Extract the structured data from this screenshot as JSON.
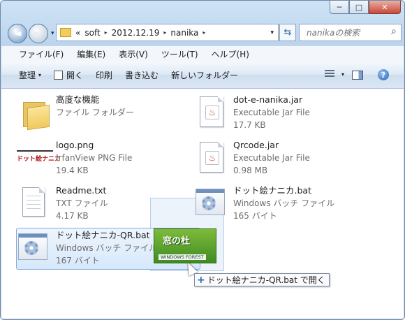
{
  "window": {
    "caption": {
      "minimize": "─",
      "maximize": "□",
      "close": "✕"
    }
  },
  "nav": {
    "back_icon": "back-arrow-icon",
    "forward_icon": "forward-arrow-icon",
    "back_glyph": "◄",
    "forward_glyph": "►",
    "history_glyph": "▾"
  },
  "address": {
    "overflow": "«",
    "crumbs": [
      "soft",
      "2012.12.19",
      "nanika"
    ],
    "separator": "▸",
    "dropdown": "▾"
  },
  "refresh_glyph": "⇆",
  "search": {
    "placeholder": "nanikaの検索",
    "icon_glyph": "⌕"
  },
  "menu": [
    "ファイル(F)",
    "編集(E)",
    "表示(V)",
    "ツール(T)",
    "ヘルプ(H)"
  ],
  "commands": {
    "organize": "整理",
    "open": "開く",
    "print": "印刷",
    "burn": "書き込む",
    "new_folder": "新しいフォルダー",
    "dropdown": "▾",
    "help": "?"
  },
  "files": [
    {
      "name": "高度な機能",
      "type": "ファイル フォルダー",
      "size": "",
      "icon": "folder-icon"
    },
    {
      "name": "dot-e-nanika.jar",
      "type": "Executable Jar File",
      "size": "17.7 KB",
      "icon": "java-jar-icon"
    },
    {
      "name": "logo.png",
      "type": "IrfanView PNG File",
      "size": "19.4 KB",
      "icon": "png-image-icon"
    },
    {
      "name": "Qrcode.jar",
      "type": "Executable Jar File",
      "size": "0.98 MB",
      "icon": "java-jar-icon"
    },
    {
      "name": "Readme.txt",
      "type": "TXT ファイル",
      "size": "4.17 KB",
      "icon": "text-document-icon"
    },
    {
      "name": "ドット絵ナニカ.bat",
      "type": "Windows バッチ ファイル",
      "size": "165 バイト",
      "icon": "batch-file-icon"
    },
    {
      "name": "ドット絵ナニカ-QR.bat",
      "type": "Windows バッチ ファイル",
      "size": "167 バイト",
      "icon": "batch-file-icon",
      "selected": true
    }
  ],
  "drag": {
    "thumbnail_line1": "窓の杜",
    "thumbnail_line2": "WINDOWS FOREST",
    "tooltip": "ドット絵ナニカ-QR.bat で開く",
    "tooltip_glyph": "+"
  },
  "colors": {
    "selection": "#d6e8fb",
    "chrome": "#bcd5ee",
    "accent": "#2b63b7"
  }
}
